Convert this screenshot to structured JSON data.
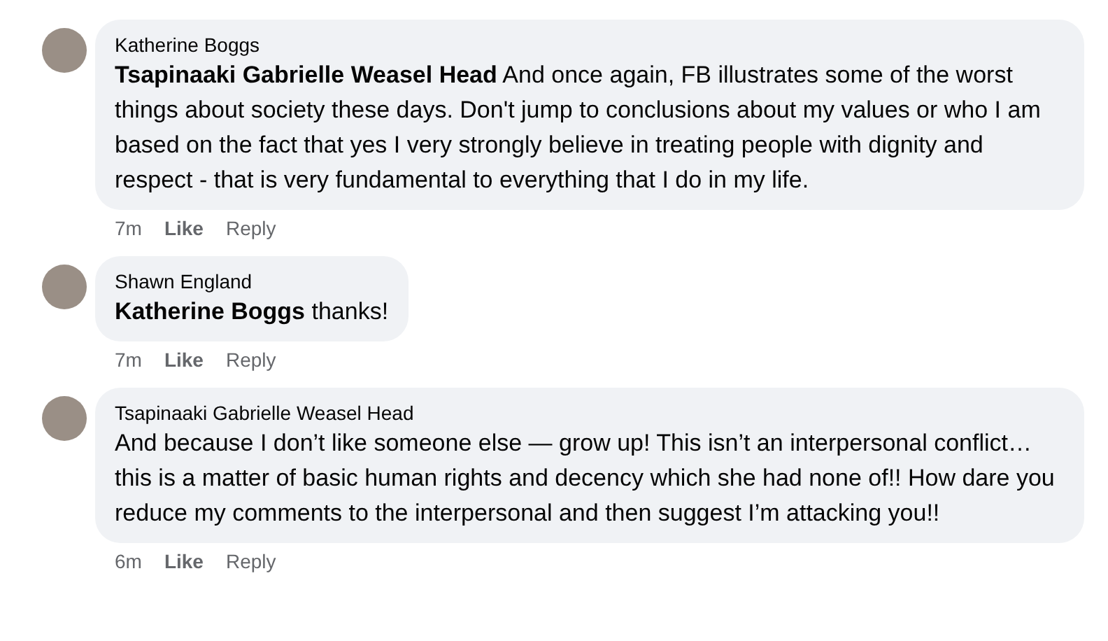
{
  "comments": [
    {
      "author": "Katherine Boggs",
      "text": "**Tsapinaaki Gabrielle Weasel Head** And once again, FB illustrates some of the worst things about society these days. Don't jump to conclusions about my values or who I am based on the fact that yes I very strongly believe in treating people with dignity and respect - that is very fundamental to everything that I do in my life.",
      "time": "7m",
      "like": "Like",
      "reply": "Reply"
    },
    {
      "author": "Shawn England",
      "text": "**Katherine Boggs** thanks!",
      "time": "7m",
      "like": "Like",
      "reply": "Reply"
    },
    {
      "author": "Tsapinaaki Gabrielle Weasel Head",
      "text": "And because I don’t like someone else — grow up! This isn’t an interpersonal conflict… this is a matter of basic human rights and decency which she had none of!! How dare you reduce my comments to the interpersonal and then suggest I’m attacking you!!",
      "time": "6m",
      "like": "Like",
      "reply": "Reply"
    }
  ]
}
